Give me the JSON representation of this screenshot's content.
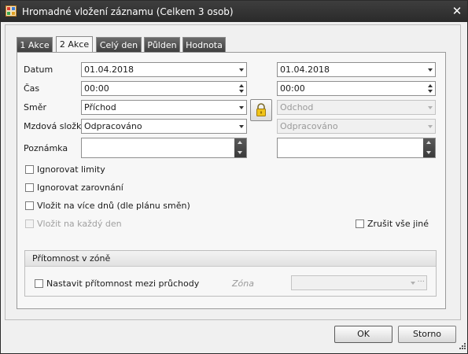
{
  "window": {
    "title": "Hromadné vložení záznamu (Celkem 3 osob)",
    "close_glyph": "✕"
  },
  "tabs": [
    {
      "label": "1 Akce",
      "active": false
    },
    {
      "label": "2 Akce",
      "active": true
    },
    {
      "label": "Celý den",
      "active": false
    },
    {
      "label": "Půlden",
      "active": false
    },
    {
      "label": "Hodnota",
      "active": false
    }
  ],
  "form": {
    "date_label": "Datum",
    "time_label": "Čas",
    "direction_label": "Směr",
    "wage_label": "Mzdová složka",
    "note_label": "Poznámka",
    "date_from": "01.04.2018",
    "date_to": "01.04.2018",
    "time_from": "00:00",
    "time_to": "00:00",
    "direction_from": "Příchod",
    "direction_to": "Odchod",
    "wage_from": "Odpracováno",
    "wage_to": "Odpracováno",
    "note_from": "",
    "note_to": ""
  },
  "checkboxes": {
    "ignore_limits": "Ignorovat limity",
    "ignore_rounding": "Ignorovat zarovnání",
    "multi_day": "Vložit na více dnů (dle plánu směn)",
    "every_day": "Vložit na každý den",
    "cancel_others": "Zrušit vše jiné"
  },
  "presence": {
    "title": "Přítomnost v zóně",
    "set_between_label": "Nastavit přítomnost mezi průchody",
    "zone_label": "Zóna",
    "zone_value": ""
  },
  "buttons": {
    "ok": "OK",
    "cancel": "Storno"
  },
  "colors": {
    "titlebar": "#2f2f2f",
    "tab_inactive": "#4a4a4a",
    "lock": "#e6b800"
  },
  "icons": {
    "app": "app-icon",
    "lock": "lock-icon",
    "close": "close-icon",
    "grip": "resize-grip-icon"
  }
}
